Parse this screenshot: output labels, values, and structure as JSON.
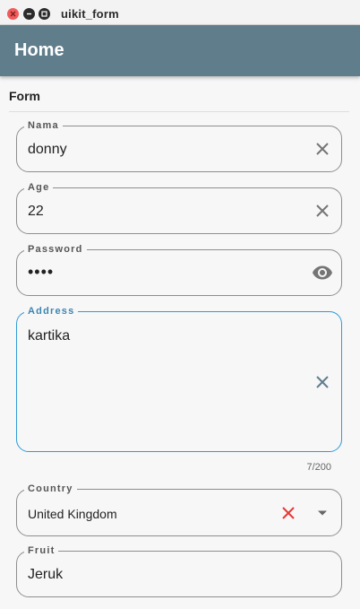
{
  "window": {
    "title": "uikit_form"
  },
  "appbar": {
    "title": "Home"
  },
  "form": {
    "section_title": "Form",
    "fields": {
      "nama": {
        "label": "Nama",
        "value": "donny"
      },
      "age": {
        "label": "Age",
        "value": "22"
      },
      "password": {
        "label": "Password",
        "value": "••••"
      },
      "address": {
        "label": "Address",
        "value": "kartika",
        "counter": "7/200"
      },
      "country": {
        "label": "Country",
        "value": "United Kingdom"
      },
      "fruit": {
        "label": "Fruit",
        "value": "Jeruk"
      }
    }
  },
  "icons": {
    "clear": "close-icon",
    "visibility": "eye-icon",
    "dropdown": "caret-down-icon",
    "window_close": "close-icon",
    "window_minimize": "minimize-icon",
    "window_maximize": "maximize-icon"
  },
  "colors": {
    "appbar": "#607d8b",
    "focus_border": "#2e9bd6",
    "clear_red": "#e53935",
    "close_button": "#f25b5b"
  }
}
